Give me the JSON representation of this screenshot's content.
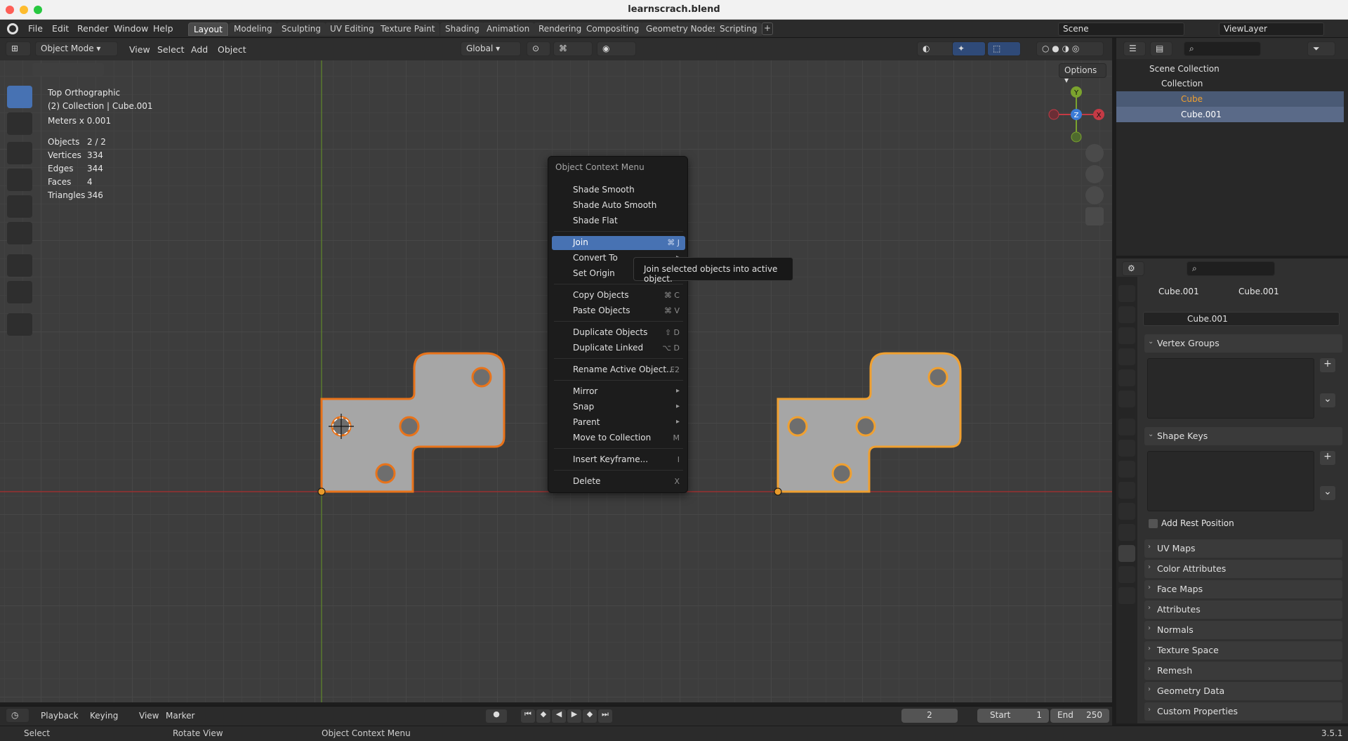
{
  "window": {
    "title": "learnscrach.blend"
  },
  "menu": [
    "File",
    "Edit",
    "Render",
    "Window",
    "Help"
  ],
  "workspaces": [
    "Layout",
    "Modeling",
    "Sculpting",
    "UV Editing",
    "Texture Paint",
    "Shading",
    "Animation",
    "Rendering",
    "Compositing",
    "Geometry Nodes",
    "Scripting"
  ],
  "active_workspace": "Layout",
  "scene": {
    "name": "Scene",
    "view_layer": "ViewLayer"
  },
  "viewport_header": {
    "mode": "Object Mode",
    "menus": [
      "View",
      "Select",
      "Add",
      "Object"
    ],
    "orientation": "Global",
    "options_label": "Options"
  },
  "viewport_overlay": {
    "view_name": "Top Orthographic",
    "collection_info": "(2) Collection | Cube.001",
    "units": "Meters x 0.001",
    "stats": [
      {
        "label": "Objects",
        "value": "2 / 2"
      },
      {
        "label": "Vertices",
        "value": "334"
      },
      {
        "label": "Edges",
        "value": "344"
      },
      {
        "label": "Faces",
        "value": "4"
      },
      {
        "label": "Triangles",
        "value": "346"
      }
    ]
  },
  "gizmo": {
    "x": "X",
    "y": "Y",
    "z": "Z"
  },
  "context_menu": {
    "title": "Object Context Menu",
    "groups": [
      [
        {
          "label": "Shade Smooth",
          "shortcut": ""
        },
        {
          "label": "Shade Auto Smooth",
          "shortcut": ""
        },
        {
          "label": "Shade Flat",
          "shortcut": ""
        }
      ],
      [
        {
          "label": "Join",
          "shortcut": "⌘ J"
        },
        {
          "label": "Convert To",
          "shortcut": ""
        },
        {
          "label": "Set Origin",
          "shortcut": ""
        }
      ],
      [
        {
          "label": "Copy Objects",
          "shortcut": "⌘ C"
        },
        {
          "label": "Paste Objects",
          "shortcut": "⌘ V"
        }
      ],
      [
        {
          "label": "Duplicate Objects",
          "shortcut": "⇧ D"
        },
        {
          "label": "Duplicate Linked",
          "shortcut": "⌥ D"
        }
      ],
      [
        {
          "label": "Rename Active Object...",
          "shortcut": "F2"
        }
      ],
      [
        {
          "label": "Mirror",
          "shortcut": ""
        },
        {
          "label": "Snap",
          "shortcut": ""
        },
        {
          "label": "Parent",
          "shortcut": ""
        },
        {
          "label": "Move to Collection",
          "shortcut": "M"
        }
      ],
      [
        {
          "label": "Insert Keyframe...",
          "shortcut": "I"
        }
      ],
      [
        {
          "label": "Delete",
          "shortcut": "X"
        }
      ]
    ],
    "highlighted": "Join",
    "tooltip": "Join selected objects into active object."
  },
  "outliner": {
    "root": "Scene Collection",
    "collection": "Collection",
    "objects": [
      "Cube",
      "Cube.001"
    ]
  },
  "properties": {
    "breadcrumb_object": "Cube.001",
    "breadcrumb_data": "Cube.001",
    "data_name": "Cube.001",
    "panels_open": [
      "Vertex Groups",
      "Shape Keys"
    ],
    "add_rest_position": "Add Rest Position",
    "panels_closed": [
      "UV Maps",
      "Color Attributes",
      "Face Maps",
      "Attributes",
      "Normals",
      "Texture Space",
      "Remesh",
      "Geometry Data",
      "Custom Properties"
    ]
  },
  "timeline": {
    "menus": [
      "Playback",
      "Keying",
      "View",
      "Marker"
    ],
    "current_frame": "2",
    "start_label": "Start",
    "start": "1",
    "end_label": "End",
    "end": "250"
  },
  "statusbar": {
    "left": "Select",
    "middle": "Rotate View",
    "right": "Object Context Menu",
    "version": "3.5.1"
  },
  "colors": {
    "accent": "#4772b3",
    "selected_outline": "#e8731a",
    "active_outline": "#f0a030",
    "object_fill": "#a6a6a6"
  }
}
